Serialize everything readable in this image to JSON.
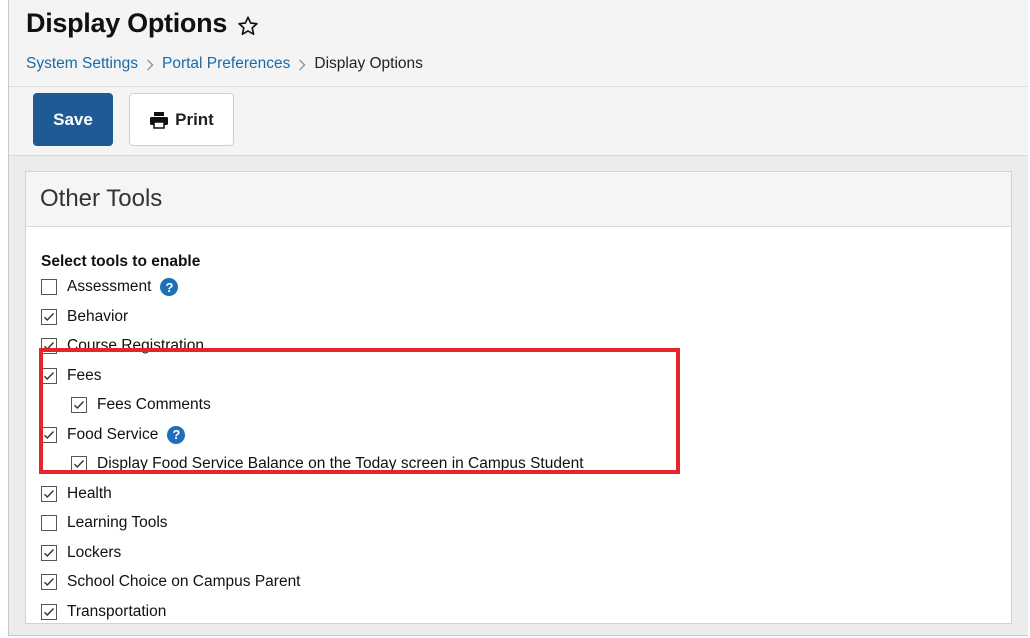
{
  "page": {
    "title": "Display Options"
  },
  "breadcrumb": {
    "items": [
      "System Settings",
      "Portal Preferences"
    ],
    "current": "Display Options"
  },
  "toolbar": {
    "save_label": "Save",
    "print_label": "Print"
  },
  "panel": {
    "title": "Other Tools",
    "section_label": "Select tools to enable"
  },
  "tools": [
    {
      "label": "Assessment",
      "checked": false,
      "help": true,
      "indent": 0
    },
    {
      "label": "Behavior",
      "checked": true,
      "help": false,
      "indent": 0
    },
    {
      "label": "Course Registration",
      "checked": true,
      "help": false,
      "indent": 0
    },
    {
      "label": "Fees",
      "checked": true,
      "help": false,
      "indent": 0
    },
    {
      "label": "Fees Comments",
      "checked": true,
      "help": false,
      "indent": 1
    },
    {
      "label": "Food Service",
      "checked": true,
      "help": true,
      "indent": 0
    },
    {
      "label": "Display Food Service Balance on the Today screen in Campus Student",
      "checked": true,
      "help": false,
      "indent": 1
    },
    {
      "label": "Health",
      "checked": true,
      "help": false,
      "indent": 0
    },
    {
      "label": "Learning Tools",
      "checked": false,
      "help": false,
      "indent": 0
    },
    {
      "label": "Lockers",
      "checked": true,
      "help": false,
      "indent": 0
    },
    {
      "label": "School Choice on Campus Parent",
      "checked": true,
      "help": false,
      "indent": 0
    },
    {
      "label": "Transportation",
      "checked": true,
      "help": false,
      "indent": 0
    }
  ],
  "help_glyph": "?",
  "colors": {
    "accent": "#1e5a96",
    "link": "#1a6aa7",
    "highlight": "#e8242b",
    "help_icon": "#1e6fb8"
  }
}
